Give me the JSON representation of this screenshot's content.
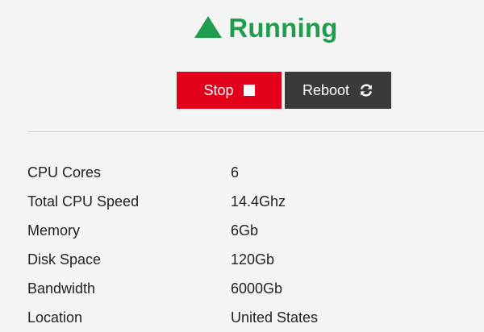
{
  "status": {
    "label": "Running",
    "icon": "triangle-up-icon",
    "color": "#1f9d4c"
  },
  "actions": {
    "stop": {
      "label": "Stop",
      "icon": "stop-square-icon",
      "color": "#e2001a"
    },
    "reboot": {
      "label": "Reboot",
      "icon": "refresh-icon",
      "color": "#3a3a3a"
    }
  },
  "specs": [
    {
      "label": "CPU Cores",
      "value": "6"
    },
    {
      "label": "Total CPU Speed",
      "value": "14.4Ghz"
    },
    {
      "label": "Memory",
      "value": "6Gb"
    },
    {
      "label": "Disk Space",
      "value": "120Gb"
    },
    {
      "label": "Bandwidth",
      "value": "6000Gb"
    },
    {
      "label": "Location",
      "value": "United States"
    }
  ]
}
